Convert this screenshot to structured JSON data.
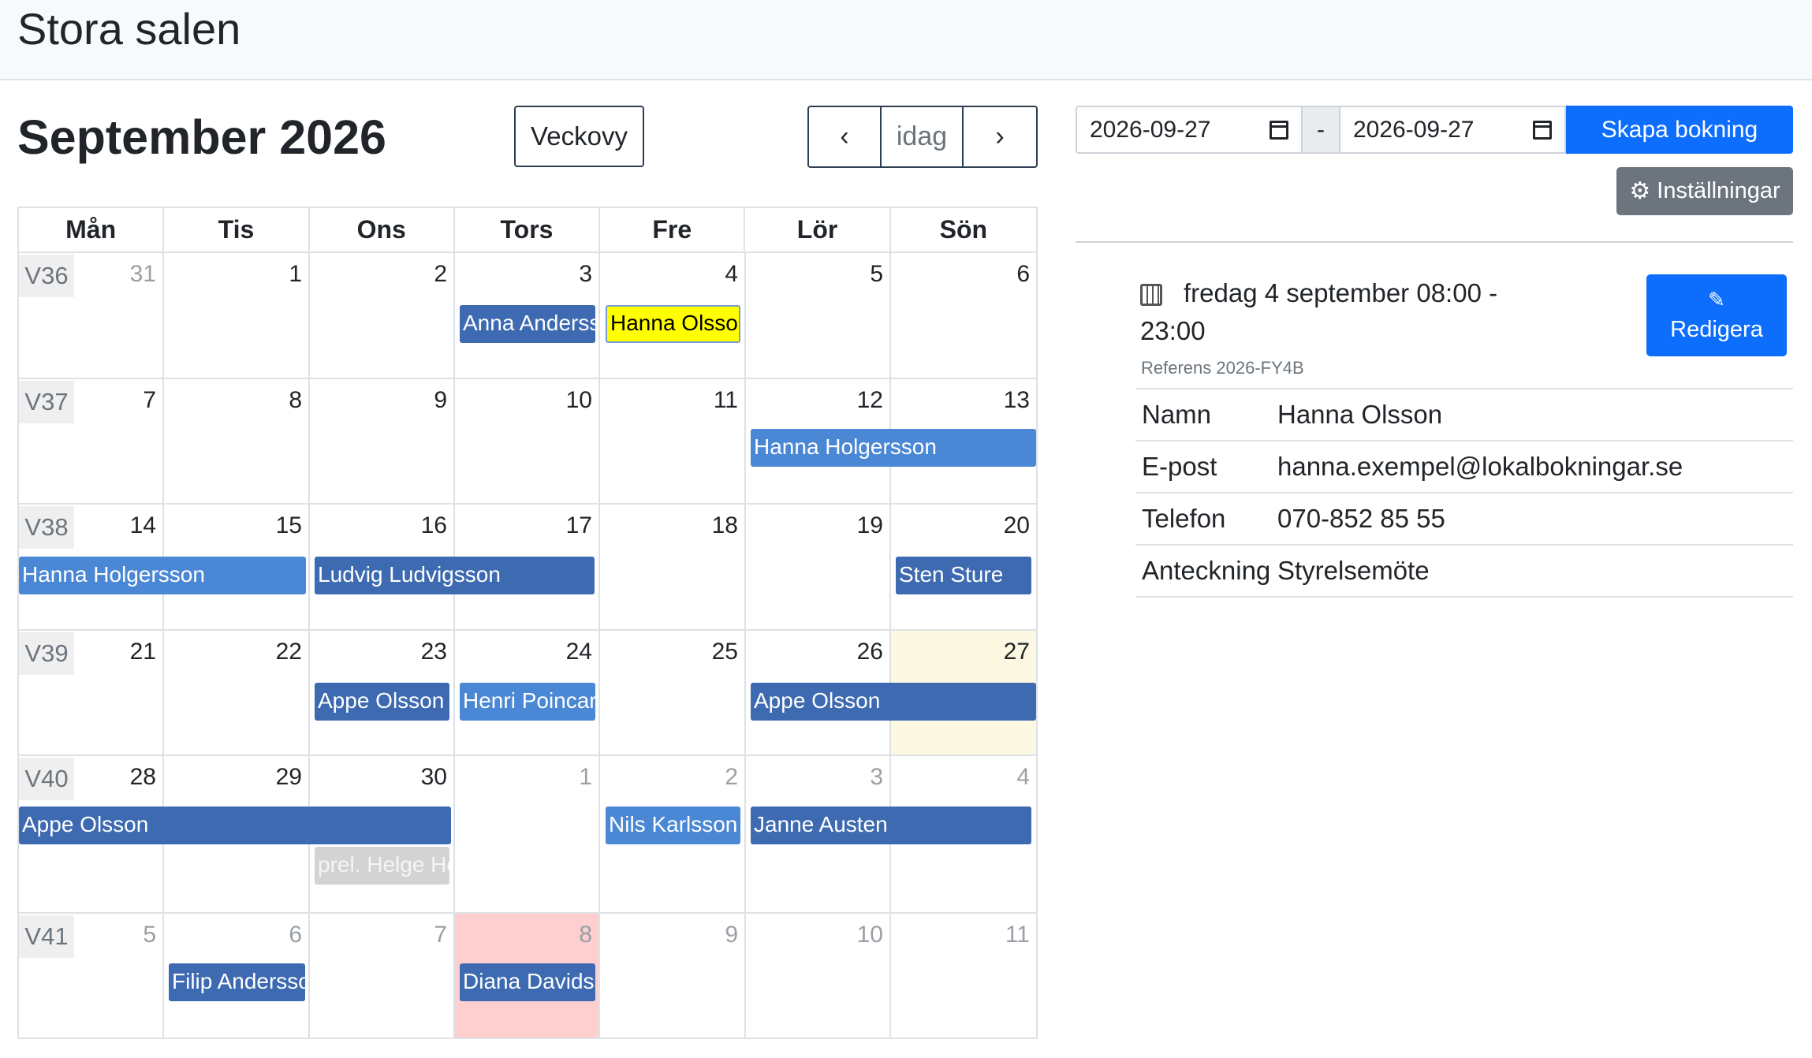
{
  "page_title": "Stora salen",
  "month_title": "September 2026",
  "toolbar": {
    "week_view": "Veckovy",
    "prev": "‹",
    "today": "idag",
    "next": "›"
  },
  "weekdays": [
    "Mån",
    "Tis",
    "Ons",
    "Tors",
    "Fre",
    "Lör",
    "Sön"
  ],
  "weeks": [
    {
      "label": "V36",
      "days": [
        "31",
        "1",
        "2",
        "3",
        "4",
        "5",
        "6"
      ]
    },
    {
      "label": "V37",
      "days": [
        "7",
        "8",
        "9",
        "10",
        "11",
        "12",
        "13"
      ]
    },
    {
      "label": "V38",
      "days": [
        "14",
        "15",
        "16",
        "17",
        "18",
        "19",
        "20"
      ]
    },
    {
      "label": "V39",
      "days": [
        "21",
        "22",
        "23",
        "24",
        "25",
        "26",
        "27"
      ]
    },
    {
      "label": "V40",
      "days": [
        "28",
        "29",
        "30",
        "1",
        "2",
        "3",
        "4"
      ]
    },
    {
      "label": "V41",
      "days": [
        "5",
        "6",
        "7",
        "8",
        "9",
        "10",
        "11"
      ]
    }
  ],
  "events": [
    {
      "label": "Anna Andersson",
      "style": "dark"
    },
    {
      "label": "Hanna Olsson",
      "style": "yellow"
    },
    {
      "label": "Hanna Holgersson",
      "style": "light"
    },
    {
      "label": "Hanna Holgersson",
      "style": "light"
    },
    {
      "label": "Ludvig Ludvigsson",
      "style": "dark"
    },
    {
      "label": "Sten Sture",
      "style": "dark"
    },
    {
      "label": "Appe Olsson",
      "style": "dark"
    },
    {
      "label": "Henri Poincaré",
      "style": "light"
    },
    {
      "label": "Appe Olsson",
      "style": "dark"
    },
    {
      "label": "Appe Olsson",
      "style": "dark"
    },
    {
      "label": "prel. Helge Hörnell",
      "style": "grey"
    },
    {
      "label": "Nils Karlsson",
      "style": "light"
    },
    {
      "label": "Janne Austen",
      "style": "dark"
    },
    {
      "label": "Filip Andersson",
      "style": "dark"
    },
    {
      "label": "Diana Davidsson",
      "style": "dark"
    }
  ],
  "booking_form": {
    "date_from": "2026-09-27",
    "separator": "-",
    "date_to": "2026-09-27",
    "create_label": "Skapa bokning",
    "settings_label": "Inställningar"
  },
  "detail": {
    "date_text": "fredag 4 september 08:00 - 23:00",
    "reference": "Referens 2026-FY4B",
    "edit_label": "Redigera",
    "rows": [
      {
        "key": "Namn",
        "value": "Hanna Olsson"
      },
      {
        "key": "E-post",
        "value": "hanna.exempel@lokalbokningar.se"
      },
      {
        "key": "Telefon",
        "value": "070-852 85 55"
      },
      {
        "key": "Anteckning",
        "value": "Styrelsemöte"
      }
    ]
  },
  "colors": {
    "event_dark": "#3d6ab0",
    "event_light": "#4a87d4",
    "highlight_selected": "#ffff00",
    "today_cell": "#fdf8e1",
    "blocked_cell": "#fdcfcf",
    "primary": "#0d6efd"
  }
}
